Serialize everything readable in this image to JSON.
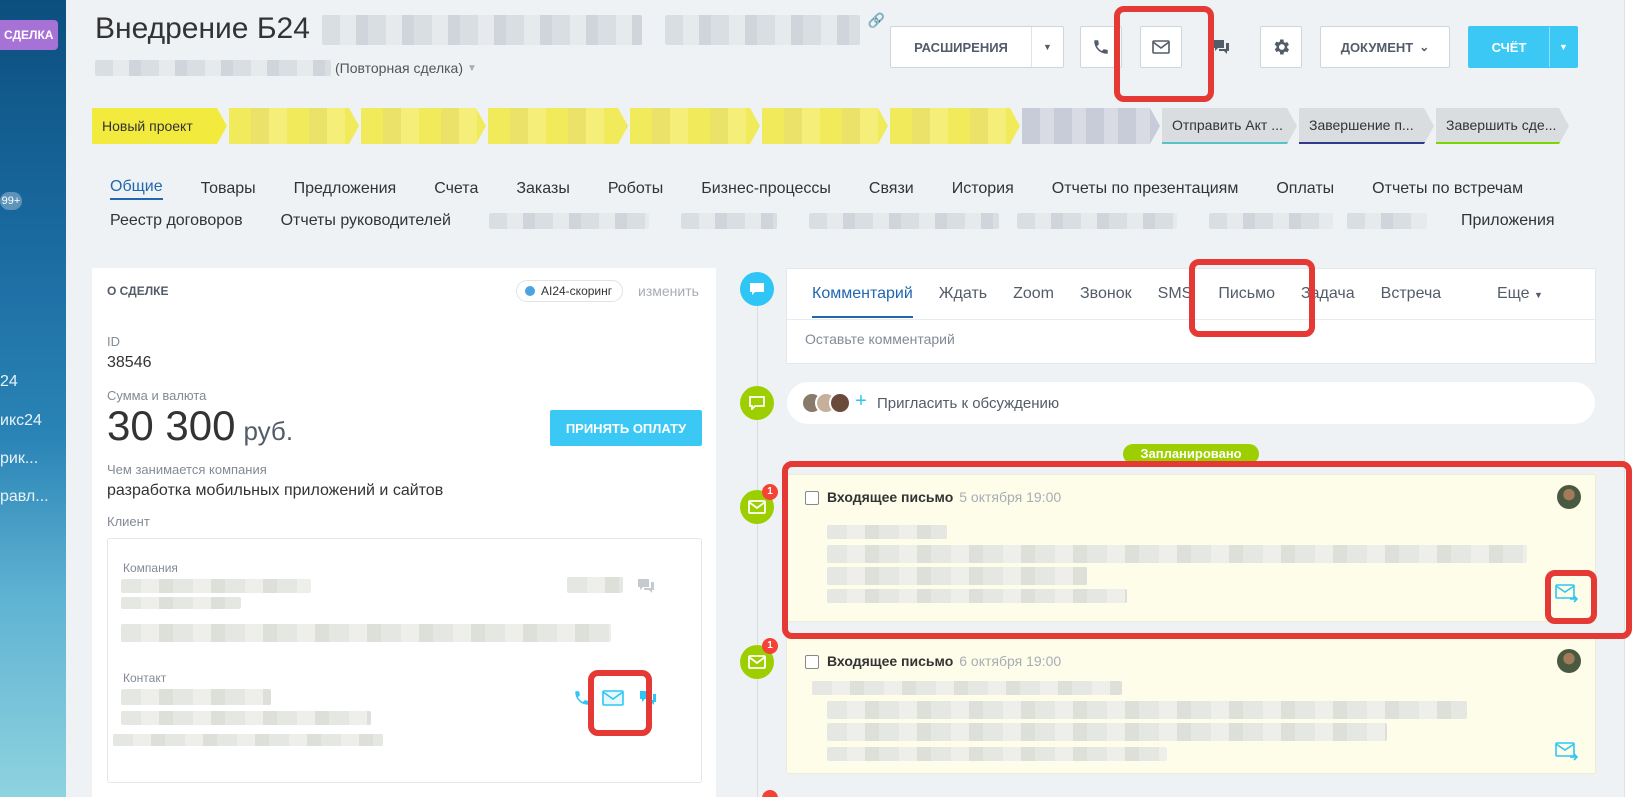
{
  "sidebar": {
    "tag": "СДЕЛКА",
    "badge": "99+",
    "items": [
      "24",
      "икс24",
      "рик...",
      "равл..."
    ]
  },
  "header": {
    "title": "Внедрение Б24",
    "subtitle_suffix": "(Повторная сделка)",
    "buttons": {
      "extensions": "РАСШИРЕНИЯ",
      "document": "ДОКУМЕНТ",
      "invoice": "СЧЁТ"
    }
  },
  "pipeline": {
    "first_stage": "Новый проект",
    "end_stages": [
      "Отправить Акт ...",
      "Завершение п...",
      "Завершить сде..."
    ]
  },
  "tabs": {
    "row1": [
      "Общие",
      "Товары",
      "Предложения",
      "Счета",
      "Заказы",
      "Роботы",
      "Бизнес-процессы",
      "Связи",
      "История",
      "Отчеты по презентациям",
      "Оплаты",
      "Отчеты по встречам"
    ],
    "row2_left": [
      "Реестр договоров",
      "Отчеты руководителей"
    ],
    "row2_right": "Приложения"
  },
  "deal": {
    "section_title": "О СДЕЛКЕ",
    "ai_scoring": "AI24-скоринг",
    "edit": "изменить",
    "id_label": "ID",
    "id_value": "38546",
    "sum_label": "Сумма и валюта",
    "sum_value": "30 300",
    "currency": "руб.",
    "pay_button": "ПРИНЯТЬ ОПЛАТУ",
    "company_activity_label": "Чем занимается компания",
    "company_activity_value": "разработка мобильных приложений и сайтов",
    "client_label": "Клиент",
    "company_label": "Компания",
    "contact_label": "Контакт"
  },
  "composer": {
    "tabs": [
      "Комментарий",
      "Ждать",
      "Zoom",
      "Звонок",
      "SMS",
      "Письмо",
      "Задача",
      "Встреча"
    ],
    "more": "Еще",
    "placeholder": "Оставьте комментарий"
  },
  "invite": {
    "text": "Пригласить к обсуждению"
  },
  "timeline": {
    "planned": "Запланировано",
    "items": [
      {
        "title": "Входящее письмо",
        "date": "5 октября 19:00",
        "badge": "1"
      },
      {
        "title": "Входящее письмо",
        "date": "6 октября 19:00",
        "badge": "1"
      }
    ]
  },
  "colors": {
    "accent": "#2067b0",
    "primary_button": "#3bc8f5",
    "highlight": "#e53935",
    "timeline_green": "#9dcf00",
    "timeline_blue": "#2fc6f6"
  }
}
